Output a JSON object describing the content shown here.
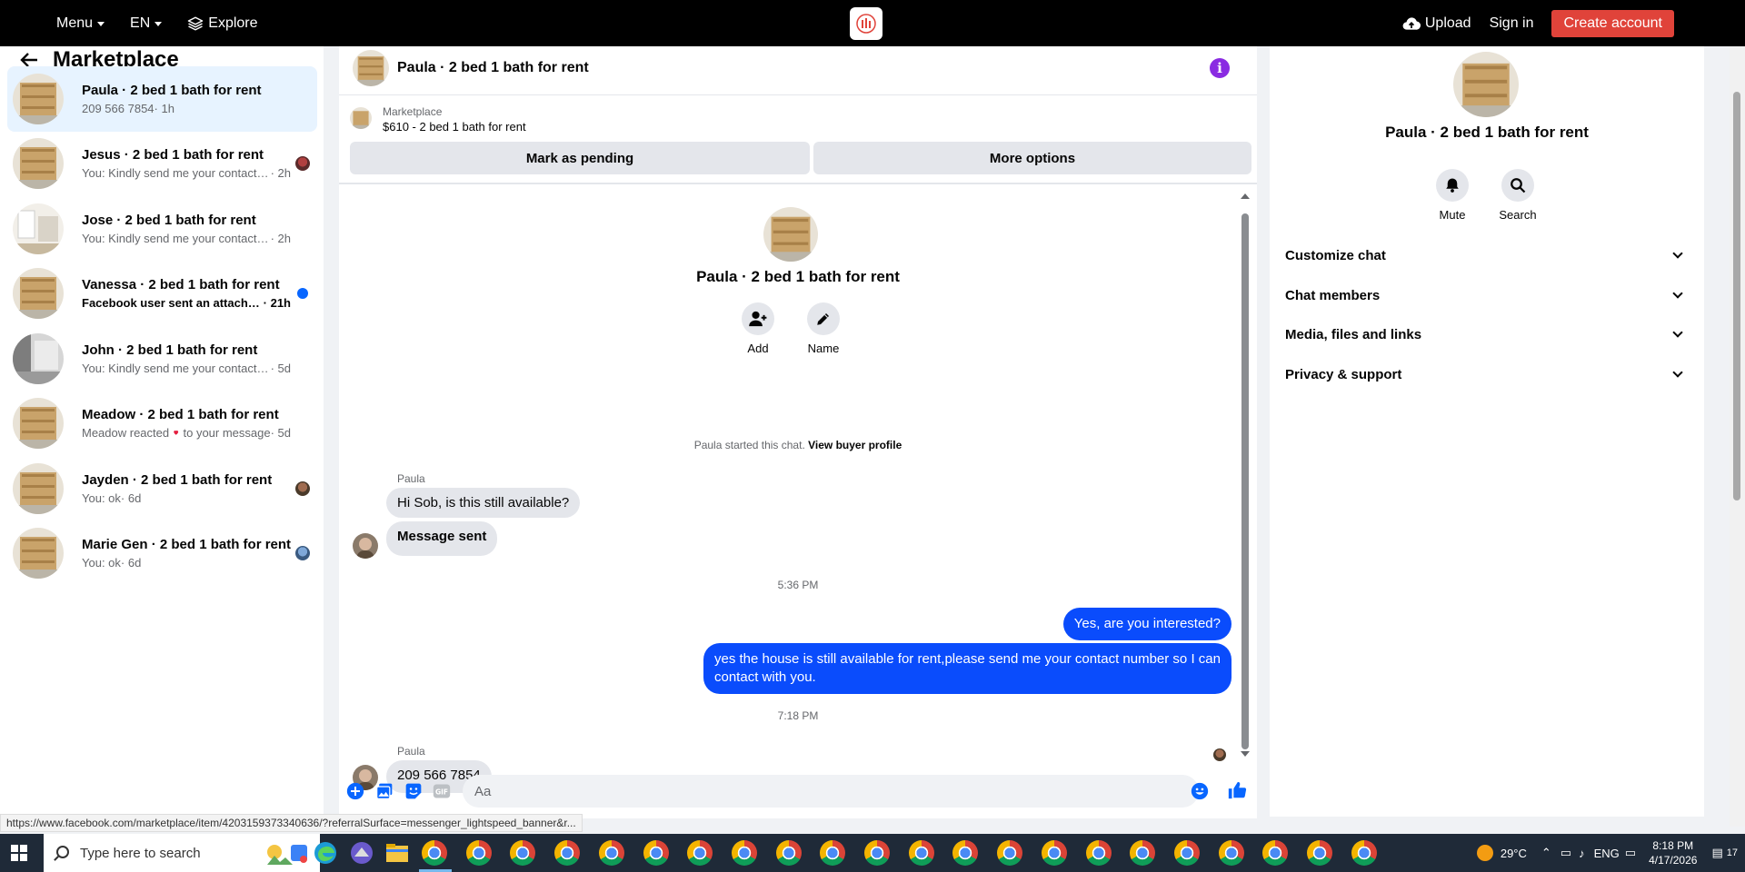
{
  "topbar": {
    "menu": "Menu",
    "lang": "EN",
    "explore": "Explore",
    "upload": "Upload",
    "signin": "Sign in",
    "create_account": "Create account",
    "accent": "#e0433a"
  },
  "sidebar": {
    "title": "Marketplace",
    "conversations": [
      {
        "name": "Paula · 2 bed 1 bath for rent",
        "preview": "209 566 7854",
        "time": "· 1h",
        "active": true
      },
      {
        "name": "Jesus · 2 bed 1 bath for rent",
        "preview": "You: Kindly send me your contact n...",
        "time": "· 2h"
      },
      {
        "name": "Jose · 2 bed 1 bath for rent",
        "preview": "You: Kindly send me your contact nu...",
        "time": "· 2h"
      },
      {
        "name": "Vanessa · 2 bed 1 bath for rent",
        "preview": "Facebook user sent an attachment.",
        "time": "· 21h",
        "unread": true
      },
      {
        "name": "John · 2 bed 1 bath for rent",
        "preview": "You: Kindly send me your contact nu...",
        "time": "· 5d"
      },
      {
        "name": "Meadow · 2 bed 1 bath for rent",
        "preview_a": "Meadow reacted",
        "preview_b": "to your message",
        "time": "· 5d"
      },
      {
        "name": "Jayden · 2 bed 1 bath for rent",
        "preview": "You: ok",
        "time": "· 6d"
      },
      {
        "name": "Marie Gen · 2 bed 1 bath for rent",
        "preview": "You: ok",
        "time": "· 6d"
      }
    ]
  },
  "chat": {
    "header_title": "Paula · 2 bed 1 bath for rent",
    "listing_source": "Marketplace",
    "listing_detail": "$610 - 2 bed 1 bath for rent",
    "mark_pending": "Mark as pending",
    "more_options": "More options",
    "intro_title": "Paula · 2 bed 1 bath for rent",
    "add_label": "Add",
    "name_label": "Name",
    "started_text": "Paula started this chat.",
    "view_profile": "View buyer profile",
    "messages": {
      "sender1": "Paula",
      "msg1": "Hi Sob, is this still available?",
      "msg2": "Message sent",
      "time1": "5:36 PM",
      "out1": "Yes, are you interested?",
      "out2": "yes the house is still available for rent,please send me your contact number so I can contact with you.",
      "time2": "7:18 PM",
      "sender2": "Paula",
      "msg3": "209 566 7854"
    },
    "composer_placeholder": "Aa",
    "outgoing_color": "#0a4cfc"
  },
  "details": {
    "title": "Paula · 2 bed 1 bath for rent",
    "mute": "Mute",
    "search": "Search",
    "sections": [
      "Customize chat",
      "Chat members",
      "Media, files and links",
      "Privacy & support"
    ]
  },
  "status_url": "https://www.facebook.com/marketplace/item/4203159373340636/?referralSurface=messenger_lightspeed_banner&r...",
  "taskbar": {
    "search_placeholder": "Type here to search",
    "temperature": "29°C",
    "lang": "ENG",
    "time": "8:18 PM",
    "date": "4/17/2026",
    "notifications": "17"
  }
}
